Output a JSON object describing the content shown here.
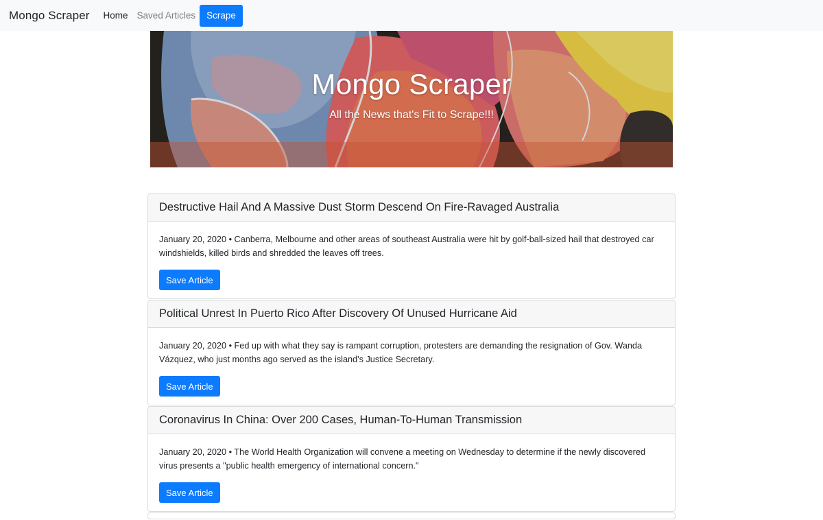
{
  "navbar": {
    "brand": "Mongo Scraper",
    "links": [
      {
        "label": "Home"
      },
      {
        "label": "Saved Articles"
      }
    ],
    "scrape_label": "Scrape"
  },
  "hero": {
    "title": "Mongo Scraper",
    "subtitle": "All the News that's Fit to Scrape!!!"
  },
  "articles": [
    {
      "headline": "Destructive Hail And A Massive Dust Storm Descend On Fire-Ravaged Australia",
      "summary": "January 20, 2020 • Canberra, Melbourne and other areas of southeast Australia were hit by golf-ball-sized hail that destroyed car windshields, killed birds and shredded the leaves off trees.",
      "button_label": "Save Article"
    },
    {
      "headline": "Political Unrest In Puerto Rico After Discovery Of Unused Hurricane Aid",
      "summary": "January 20, 2020 • Fed up with what they say is rampant corruption, protesters are demanding the resignation of Gov. Wanda Vázquez, who just months ago served as the island's Justice Secretary.",
      "button_label": "Save Article"
    },
    {
      "headline": "Coronavirus In China: Over 200 Cases, Human-To-Human Transmission",
      "summary": "January 20, 2020 • The World Health Organization will convene a meeting on Wednesday to determine if the newly discovered virus presents a \"public health emergency of international concern.\"",
      "button_label": "Save Article"
    }
  ],
  "colors": {
    "primary": "#0d7bfe",
    "navbar_bg": "#f8f9fa",
    "card_header_bg": "#f7f7f7"
  }
}
